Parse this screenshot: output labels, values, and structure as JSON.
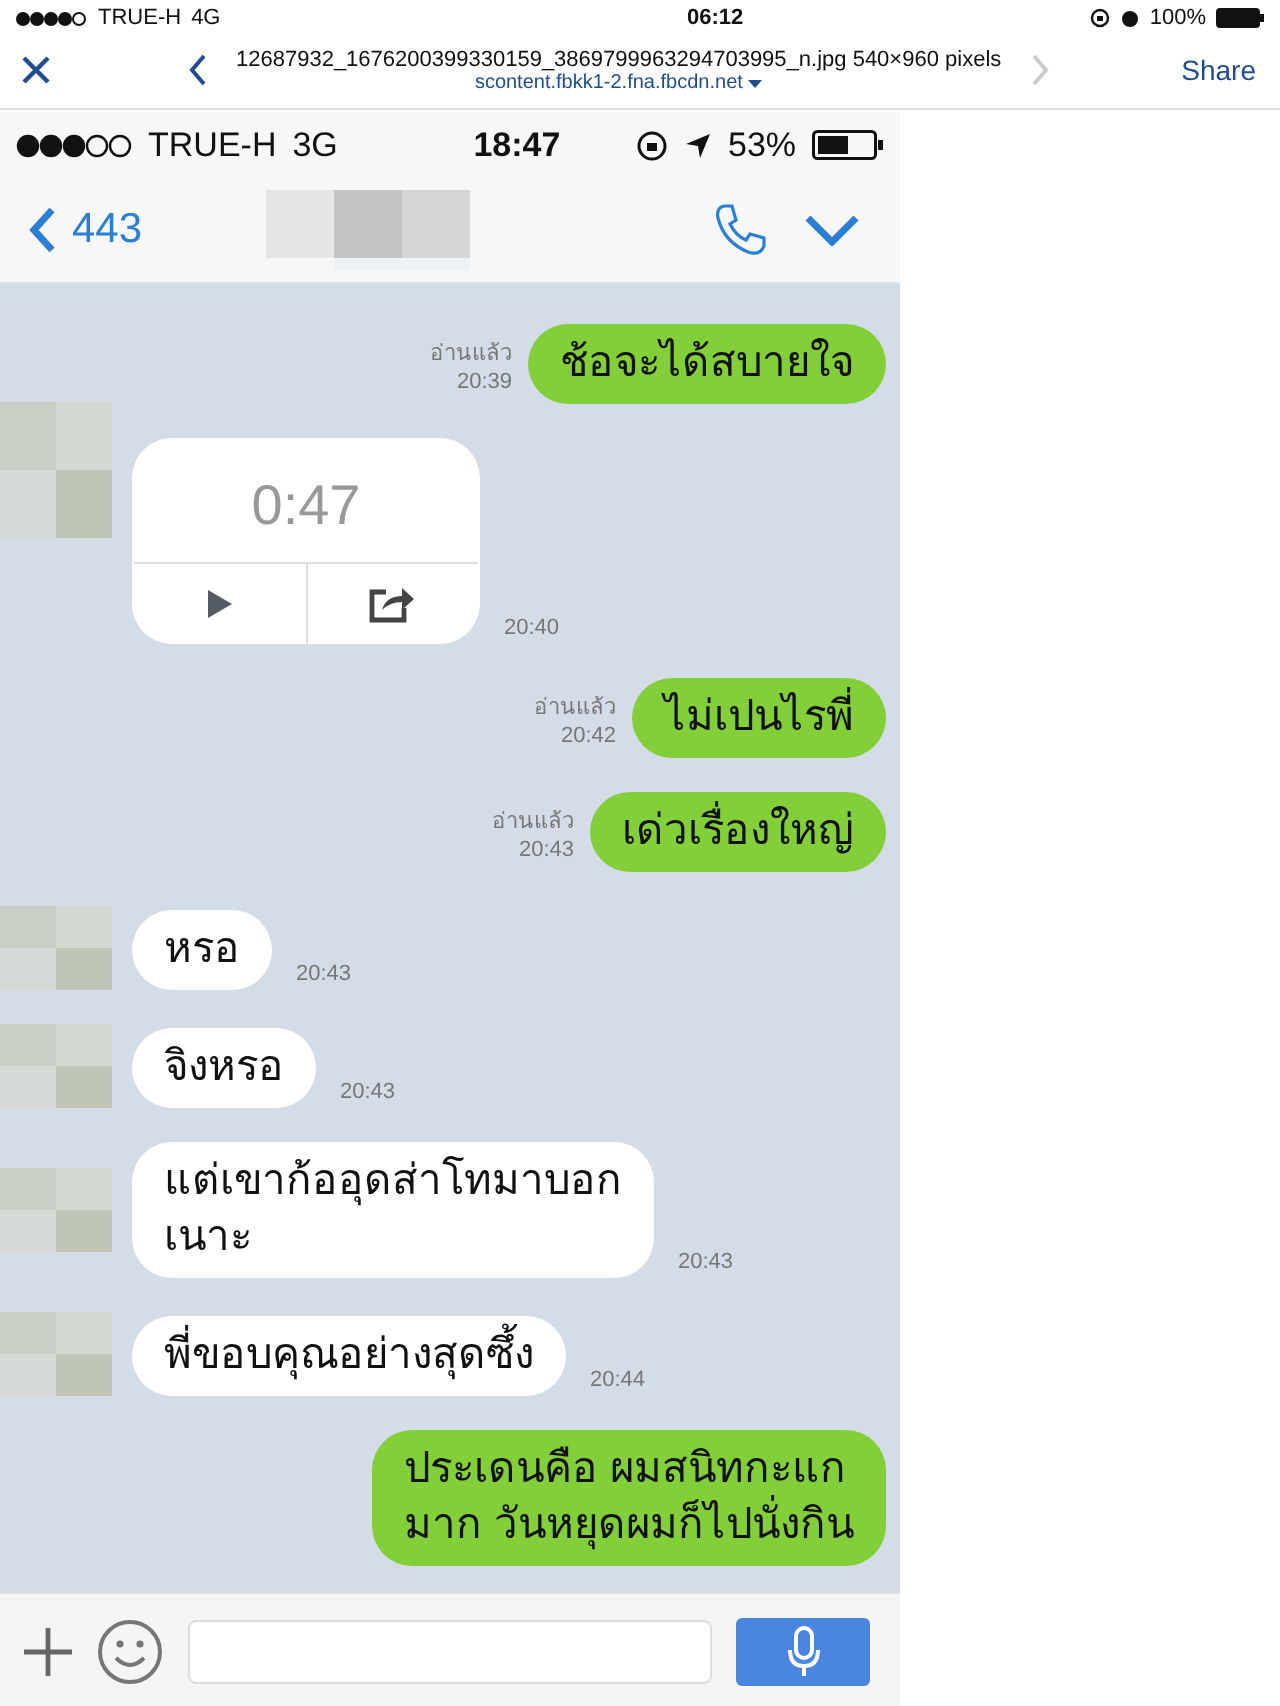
{
  "device_status_bar": {
    "carrier": "TRUE-H",
    "network": "4G",
    "time": "06:12",
    "battery": "100%"
  },
  "browser_bar": {
    "title": "12687932_1676200399330159_3869799963294703995_n.jpg 540×960 pixels",
    "url": "scontent.fbkk1-2.fna.fbcdn.net",
    "share": "Share"
  },
  "image": {
    "status_bar": {
      "carrier": "TRUE-H",
      "network": "3G",
      "time": "18:47",
      "battery": "53%"
    },
    "chat_header": {
      "back_count": "443"
    },
    "messages": [
      {
        "kind": "outgoing",
        "text": "ช้อจะได้สบายใจ",
        "read": "อ่านแล้ว",
        "time": "20:39"
      },
      {
        "kind": "voice",
        "duration": "0:47",
        "time": "20:40"
      },
      {
        "kind": "outgoing",
        "text": "ไม่เปนไรพี่",
        "read": "อ่านแล้ว",
        "time": "20:42"
      },
      {
        "kind": "outgoing",
        "text": "เด่วเรื่องใหญ่",
        "read": "อ่านแล้ว",
        "time": "20:43"
      },
      {
        "kind": "incoming",
        "text": "หรอ",
        "time": "20:43"
      },
      {
        "kind": "incoming",
        "text": "จิงหรอ",
        "time": "20:43"
      },
      {
        "kind": "incoming",
        "text": "แต่เขาก้ออุดส่าโทมาบอก\nเนาะ",
        "time": "20:43"
      },
      {
        "kind": "incoming",
        "text": "พี่ขอบคุณอย่างสุดซึ้ง",
        "time": "20:44"
      },
      {
        "kind": "outgoing",
        "text": "ประเดนคือ ผมสนิทกะแก\nมาก วันหยุดผมก็ไปนั่งกิน"
      }
    ]
  }
}
